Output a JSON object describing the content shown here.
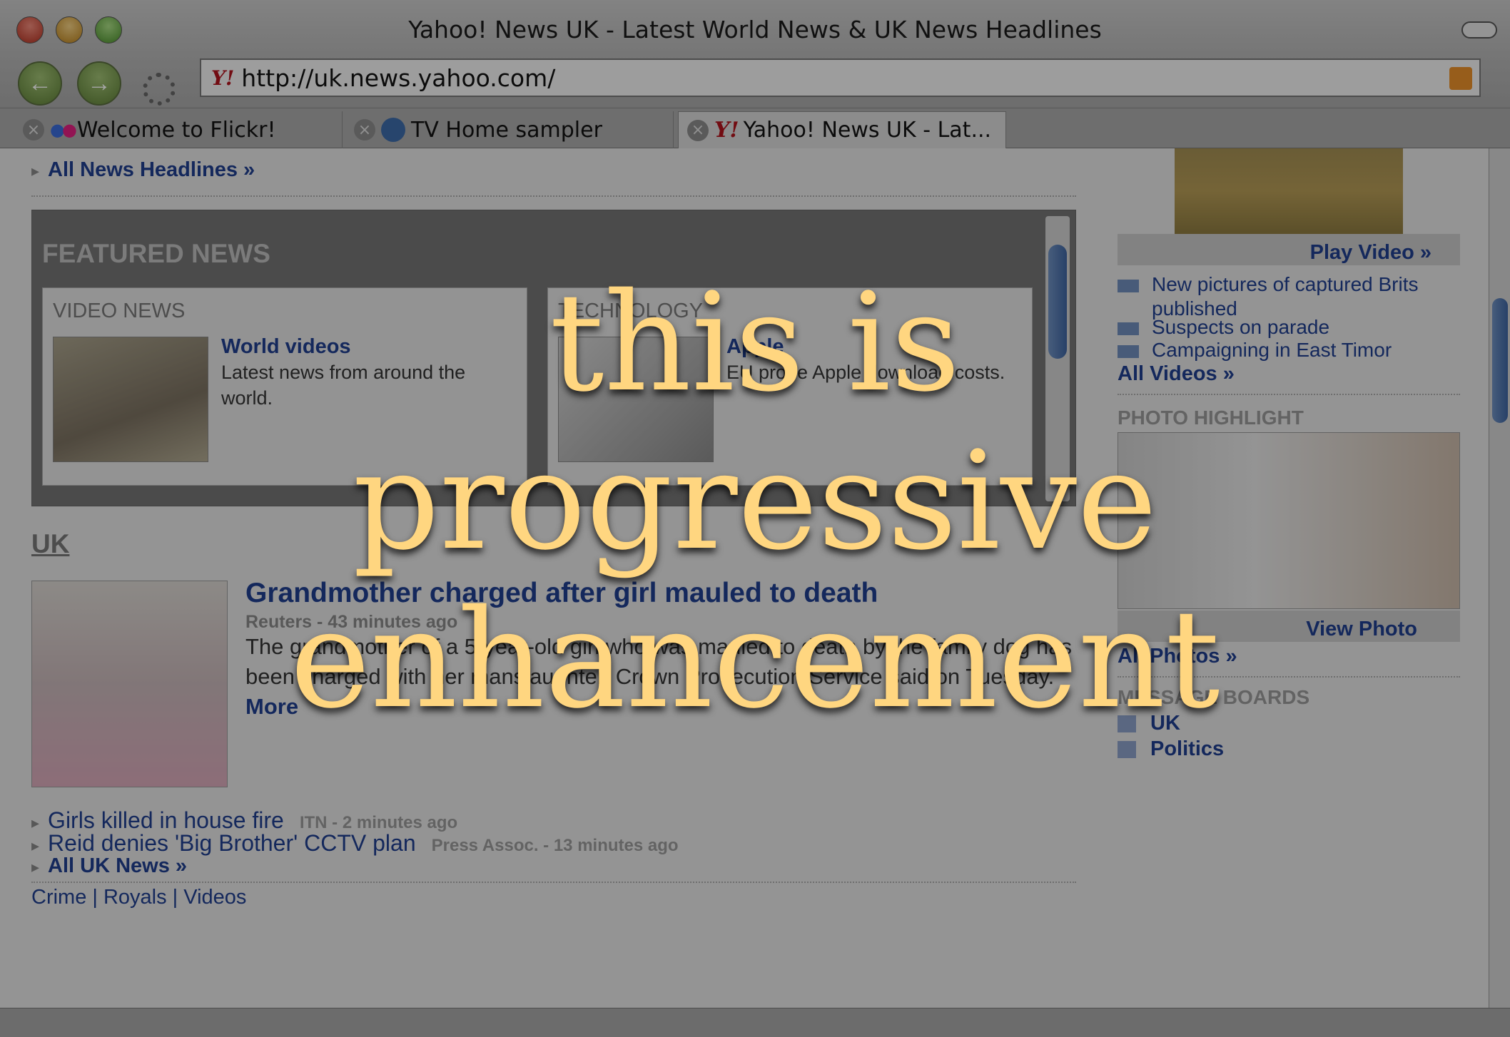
{
  "window": {
    "title": "Yahoo! News UK - Latest World News & UK News Headlines"
  },
  "toolbar": {
    "url": "http://uk.news.yahoo.com/",
    "favicon": "Y!"
  },
  "tabs": [
    {
      "label": "Welcome to Flickr!",
      "active": false
    },
    {
      "label": "TV Home sampler",
      "active": false
    },
    {
      "label": "Yahoo! News UK - Lat...",
      "active": true
    }
  ],
  "content": {
    "all_headlines": "All News Headlines »",
    "featured": {
      "title": "FEATURED NEWS",
      "video": {
        "label": "VIDEO NEWS",
        "headline": "World videos",
        "desc": "Latest news from around the world."
      },
      "tech": {
        "label": "TECHNOLOGY",
        "headline": "Apple",
        "desc": "EU probe Apple download costs."
      }
    },
    "uk": {
      "heading": "UK",
      "main_headline": "Grandmother charged after girl mauled to death",
      "main_source": "Reuters - 43 minutes ago",
      "main_body": "The grandmother of a 5-year-old girl who was mauled to death by the family dog has been charged with her manslaughter, Crown Prosecution Service said on Tuesday.",
      "more": "More",
      "items": [
        {
          "title": "Girls killed in house fire",
          "source": "ITN - 2 minutes ago"
        },
        {
          "title": "Reid denies 'Big Brother' CCTV plan",
          "source": "Press Assoc. - 13 minutes ago"
        }
      ],
      "all_uk": "All UK News »",
      "sub_links": "Crime  |  Royals  |  Videos"
    },
    "right": {
      "play_video": "Play Video »",
      "videos": [
        "New pictures of captured Brits published",
        "Suspects on parade",
        "Campaigning in East Timor"
      ],
      "all_videos": "All Videos »",
      "photo_highlight": "PHOTO HIGHLIGHT",
      "view_photo": "View Photo",
      "all_photos": "All Photos »",
      "message_boards": "MESSAGE BOARDS",
      "boards": [
        "UK",
        "Politics"
      ]
    }
  },
  "overlay": {
    "lines": [
      "this is",
      "progressive",
      "enhancement"
    ],
    "color": "#ffd680"
  }
}
